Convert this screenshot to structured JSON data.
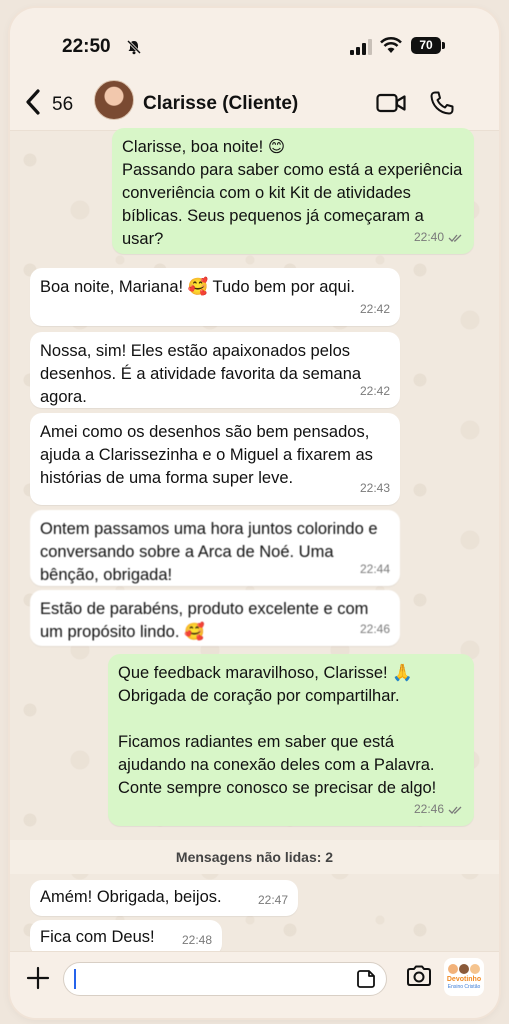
{
  "status_bar": {
    "time": "22:50",
    "battery": "70"
  },
  "header": {
    "back_count": "56",
    "contact_name": "Clarisse (Cliente)"
  },
  "messages": [
    {
      "direction": "out",
      "text": "Clarisse, boa noite! 😊\nPassando para saber como está a experiência converiência com o kit Kit de atividades bíblicas. Seus pequenos já começaram a usar?",
      "time": "22:40"
    },
    {
      "direction": "in",
      "text": "Boa noite, Mariana! 🥰 Tudo bem por aqui.",
      "time": "22:42"
    },
    {
      "direction": "in",
      "text": "Nossa, sim! Eles estão apaixonados pelos desenhos. É a atividade favorita da semana agora.",
      "time": "22:42"
    },
    {
      "direction": "in",
      "text": "Amei como os desenhos são bem pensados, ajuda a Clarissezinha e o Miguel a fixarem as histórias de uma forma super leve.",
      "time": "22:43"
    },
    {
      "direction": "in",
      "text": "Ontem passamos uma hora juntos colorindo e conversando sobre a Arca de Noé. Uma bênção, obrigada!",
      "time": "22:44"
    },
    {
      "direction": "in",
      "text": "Estão de parabéns, produto excelente e com um propósito lindo. 🥰",
      "time": "22:46"
    },
    {
      "direction": "out",
      "text": "Que feedback maravilhoso, Clarisse! 🙏\nObrigada de coração por compartilhar.\n\nFicamos radiantes em saber que está ajudando na conexão deles com a Palavra. Conte sempre conosco se precisar de algo!",
      "time": "22:46"
    },
    {
      "direction": "in",
      "text": "Amém! Obrigada, beijos.",
      "time": "22:47"
    },
    {
      "direction": "in",
      "text": "Fica com Deus!",
      "time": "22:48"
    }
  ],
  "unread_label": "Mensagens não lidas: 2",
  "input": {
    "placeholder": ""
  },
  "brand": {
    "name": "Devotinho",
    "tagline": "Ensino Cristão"
  },
  "colors": {
    "outgoing_bubble": "#d8f6c8",
    "incoming_bubble": "#ffffff",
    "caret": "#2563eb"
  }
}
